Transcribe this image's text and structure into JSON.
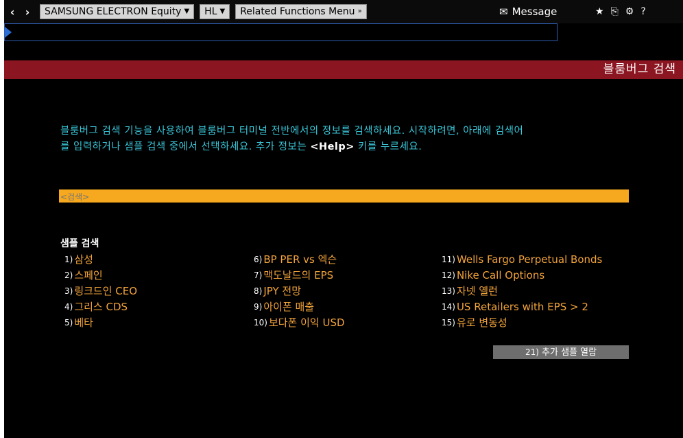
{
  "topbar": {
    "back_icon": "‹",
    "forward_icon": "›",
    "security_button": "SAMSUNG ELECTRON Equity",
    "function_button": "HL",
    "related_menu": "Related Functions Menu",
    "message_label": "Message",
    "tools": [
      "★",
      "⎘",
      "⚙",
      "?"
    ]
  },
  "command_line": {
    "value": ""
  },
  "title": "블룸버그 검색",
  "intro": {
    "line1": "블룸버그 검색 기능을 사용하여 블룸버그 터미널 전반에서의 정보를 검색하세요. 시작하려면, 아래에 검색어",
    "line2_pre": "를 입력하거나 샘플 검색 중에서 선택하세요. 추가 정보는 ",
    "help": "<Help>",
    "line2_post": " 키를 누르세요."
  },
  "search": {
    "placeholder": "<검색>"
  },
  "samples": {
    "title": "샘플 검색",
    "col1": [
      {
        "num": "1)",
        "label": "삼성"
      },
      {
        "num": "2)",
        "label": "스페인"
      },
      {
        "num": "3)",
        "label": "링크드인 CEO"
      },
      {
        "num": "4)",
        "label": "그리스 CDS"
      },
      {
        "num": "5)",
        "label": "베타"
      }
    ],
    "col2": [
      {
        "num": "6)",
        "label": "BP PER vs 엑슨"
      },
      {
        "num": "7)",
        "label": "맥도날드의 EPS"
      },
      {
        "num": "8)",
        "label": "JPY 전망"
      },
      {
        "num": "9)",
        "label": "아이폰 매출"
      },
      {
        "num": "10)",
        "label": "보다폰 이익 USD"
      }
    ],
    "col3": [
      {
        "num": "11)",
        "label": "Wells Fargo Perpetual Bonds"
      },
      {
        "num": "12)",
        "label": "Nike Call Options"
      },
      {
        "num": "13)",
        "label": "자넷 옐런"
      },
      {
        "num": "14)",
        "label": "US Retailers with EPS > 2"
      },
      {
        "num": "15)",
        "label": "유로 변동성"
      }
    ],
    "more": {
      "num": "21)",
      "label": "추가 샘플 열람"
    }
  },
  "colors": {
    "accent_title": "#8b1520",
    "search_bar": "#f6a81e",
    "intro_text": "#39c6d9",
    "sample_link": "#f2a33a"
  }
}
